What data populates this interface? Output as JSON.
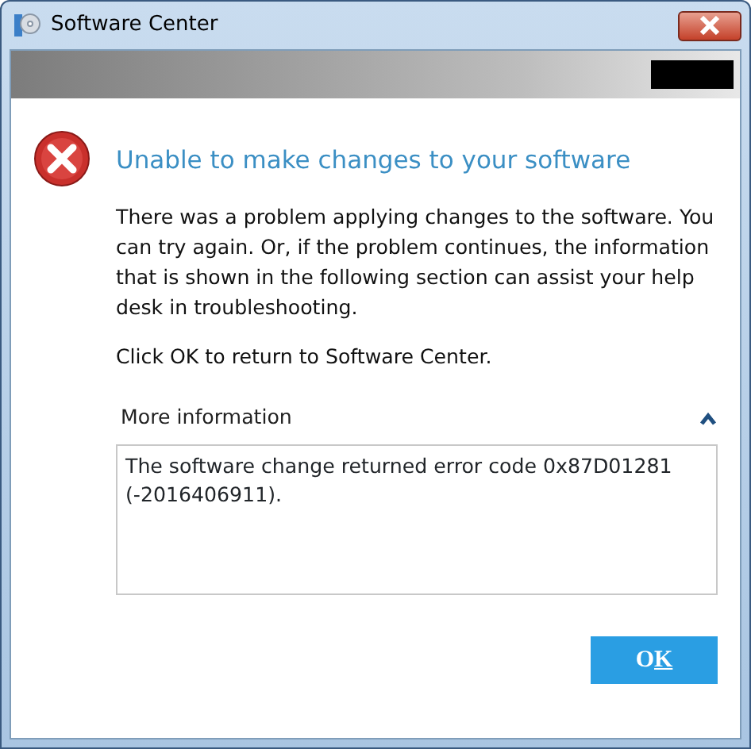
{
  "window": {
    "title": "Software Center"
  },
  "heading": "Unable to make changes to your software",
  "paragraphs": [
    "There was a problem applying changes to the software.  You can try again. Or, if the problem continues, the information that is shown in the following section can assist your help desk in troubleshooting.",
    "Click OK to return to Software Center."
  ],
  "more_information": {
    "label": "More information",
    "expanded": true,
    "details": "The software change returned error code 0x87D01281 (-2016406911)."
  },
  "buttons": [
    {
      "label_parts": [
        {
          "text": "O",
          "underlined": false
        },
        {
          "text": "K",
          "underlined": true
        }
      ]
    }
  ]
}
